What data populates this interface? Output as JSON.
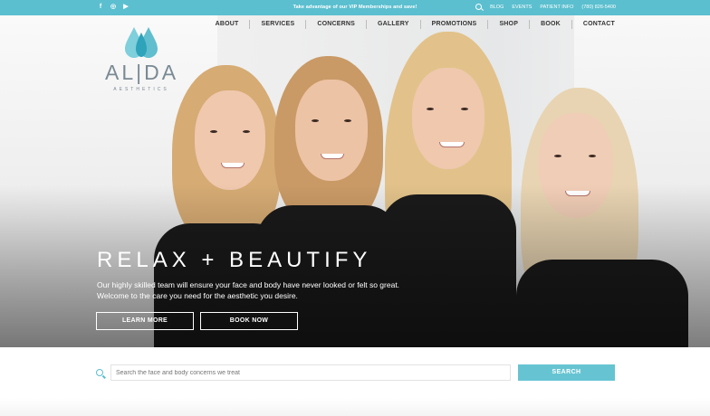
{
  "topbar": {
    "promo": "Take advantage of our VIP Memberships and save!",
    "social": [
      {
        "icon": "facebook-icon",
        "glyph": "f"
      },
      {
        "icon": "instagram-icon",
        "glyph": "◎"
      },
      {
        "icon": "youtube-icon",
        "glyph": "▶"
      }
    ],
    "links": [
      "BLOG",
      "EVENTS",
      "PATIENT INFO"
    ],
    "phone": "(780) 826-5400"
  },
  "logo": {
    "name": "AL|DA",
    "sub": "AESTHETICS"
  },
  "nav": {
    "items": [
      "ABOUT",
      "SERVICES",
      "CONCERNS",
      "GALLERY",
      "PROMOTIONS",
      "SHOP",
      "BOOK",
      "CONTACT"
    ]
  },
  "hero": {
    "headline": "RELAX + BEAUTIFY",
    "tagline": "Our highly skilled team will ensure your face and body have never looked or felt so great. Welcome to the care you need for the aesthetic you desire.",
    "learn_more": "LEARN MORE",
    "book_now": "BOOK NOW"
  },
  "search": {
    "placeholder": "Search the face and body concerns we treat",
    "button": "SEARCH"
  },
  "colors": {
    "accent": "#5bbfcf",
    "button": "#66c4d2"
  }
}
